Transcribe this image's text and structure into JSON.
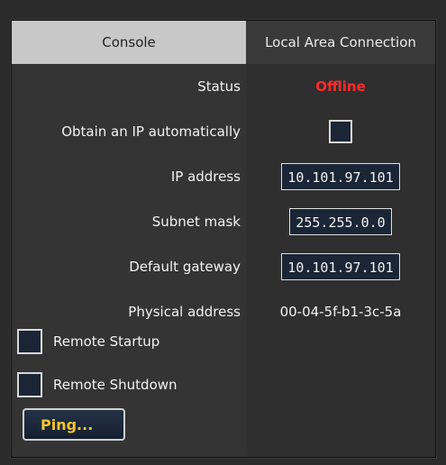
{
  "header": {
    "console_label": "Console",
    "connection_label": "Local Area Connection"
  },
  "rows": {
    "status": {
      "label": "Status",
      "value": "Offline"
    },
    "obtain_ip": {
      "label": "Obtain an IP automatically",
      "checked": false
    },
    "ip_address": {
      "label": "IP address",
      "value": "10.101.97.101"
    },
    "subnet_mask": {
      "label": "Subnet mask",
      "value": "255.255.0.0"
    },
    "default_gateway": {
      "label": "Default gateway",
      "value": "10.101.97.101"
    },
    "physical_address": {
      "label": "Physical address",
      "value": "00-04-5f-b1-3c-5a"
    }
  },
  "options": {
    "remote_startup": {
      "label": "Remote Startup",
      "checked": false
    },
    "remote_shutdown": {
      "label": "Remote Shutdown",
      "checked": false
    }
  },
  "actions": {
    "ping_label": "Ping..."
  },
  "colors": {
    "status_offline": "#ff2a2a",
    "button_text": "#f5c431",
    "field_bg": "#1a2535"
  }
}
